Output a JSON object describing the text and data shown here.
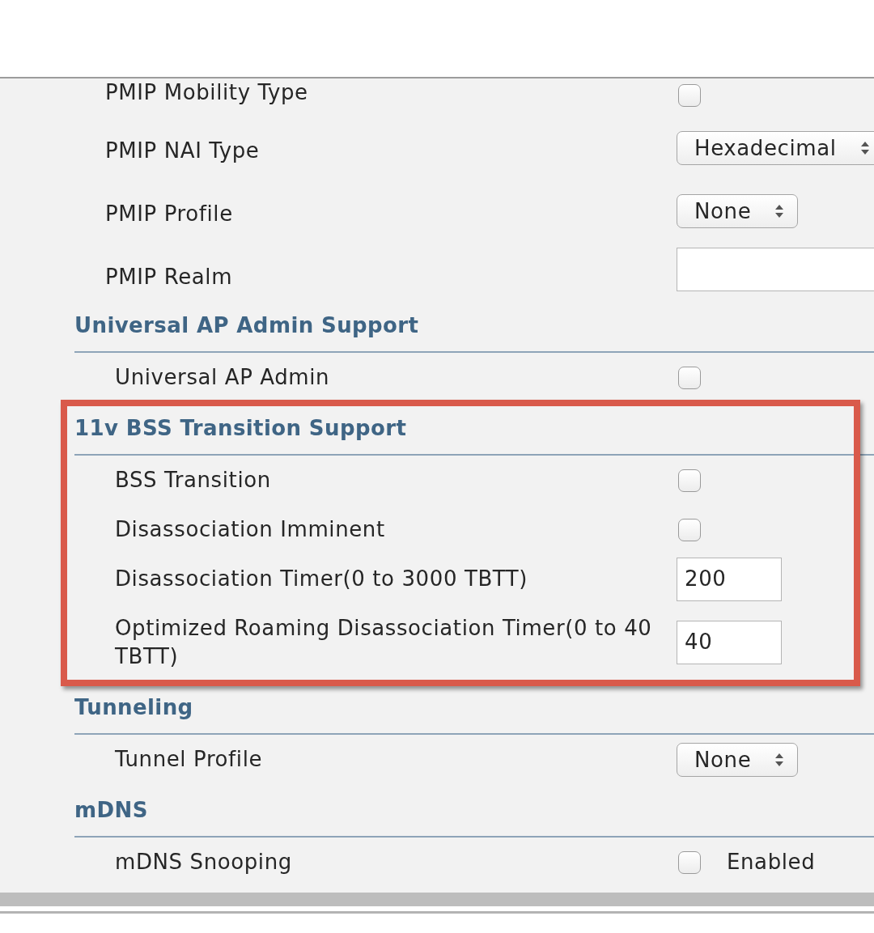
{
  "form": {
    "groups": [
      {
        "highlighted": false,
        "rows": [
          {
            "label": "PMIP Mobility Type",
            "kind": "checkbox",
            "checked": false
          },
          {
            "label": "PMIP NAI Type",
            "kind": "select",
            "value": "Hexadecimal"
          },
          {
            "label": "PMIP Profile",
            "kind": "select",
            "value": "None"
          },
          {
            "label": "PMIP Realm",
            "kind": "text"
          }
        ]
      },
      {
        "heading": "Universal AP Admin Support",
        "highlighted": false,
        "rows": [
          {
            "label": "Universal AP Admin",
            "kind": "checkbox",
            "checked": false
          }
        ]
      },
      {
        "heading": "11v BSS Transition Support",
        "highlighted": true,
        "rows": [
          {
            "label": "BSS Transition",
            "kind": "checkbox",
            "checked": false
          },
          {
            "label": "Disassociation Imminent",
            "kind": "checkbox",
            "checked": false
          },
          {
            "label": "Disassociation Timer(0 to 3000 TBTT)",
            "kind": "text",
            "value": "200"
          },
          {
            "label": "Optimized Roaming Disassociation Timer(0 to 40 TBTT)",
            "kind": "text",
            "value": "40"
          }
        ]
      },
      {
        "heading": "Tunneling",
        "highlighted": false,
        "rows": [
          {
            "label": "Tunnel Profile",
            "kind": "select",
            "value": "None"
          }
        ]
      },
      {
        "heading": "mDNS",
        "highlighted": false,
        "rows": [
          {
            "label": "mDNS Snooping",
            "kind": "checkbox",
            "checked": false,
            "option": "Enabled"
          }
        ]
      }
    ]
  }
}
